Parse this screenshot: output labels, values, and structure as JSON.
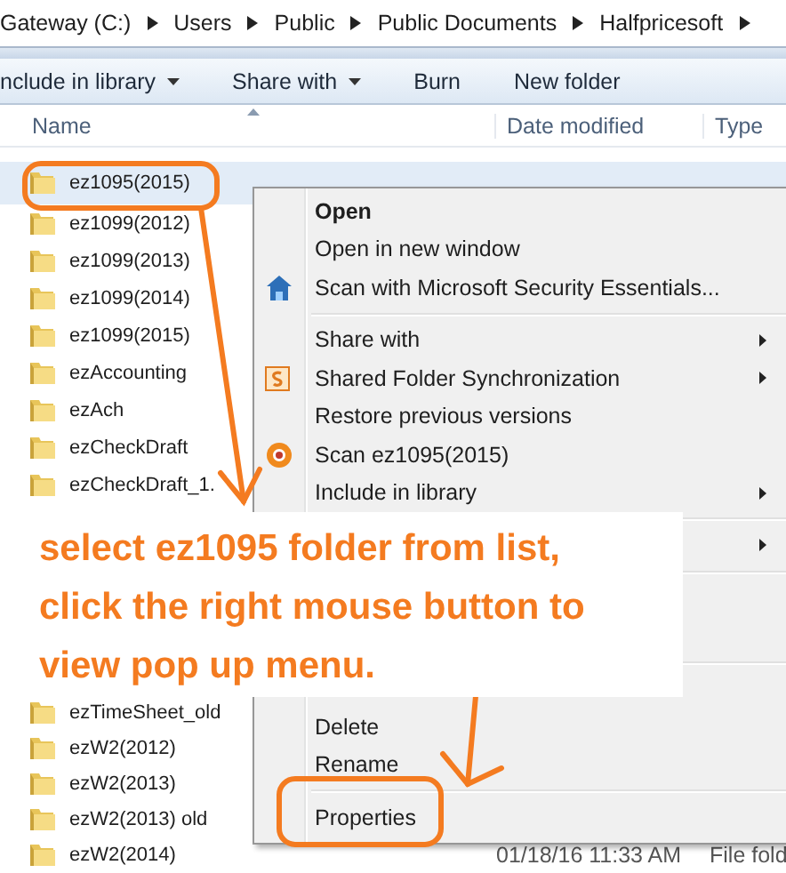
{
  "breadcrumb": [
    "Gateway (C:)",
    "Users",
    "Public",
    "Public Documents",
    "Halfpricesoft"
  ],
  "toolbar": [
    {
      "label": "nclude in library",
      "dropdown": true
    },
    {
      "label": "Share with",
      "dropdown": true
    },
    {
      "label": "Burn",
      "dropdown": false
    },
    {
      "label": "New folder",
      "dropdown": false
    }
  ],
  "columns": [
    "Name",
    "Date modified",
    "Type"
  ],
  "rows_above": [
    {
      "name": "ez1095(2015)",
      "selected": true
    },
    {
      "name": "ez1099(2012)",
      "selected": false
    },
    {
      "name": "ez1099(2013)",
      "selected": false
    },
    {
      "name": "ez1099(2014)",
      "selected": false
    },
    {
      "name": "ez1099(2015)",
      "selected": false
    },
    {
      "name": "ezAccounting",
      "selected": false
    },
    {
      "name": "ezAch",
      "selected": false
    },
    {
      "name": "ezCheckDraft",
      "selected": false
    },
    {
      "name": "ezCheckDraft_1.",
      "selected": false
    }
  ],
  "rows_below": [
    {
      "name": "ezTimeSheet_old",
      "selected": false
    },
    {
      "name": "ezW2(2012)",
      "selected": false
    },
    {
      "name": "ezW2(2013)",
      "selected": false
    },
    {
      "name": "ezW2(2013) old",
      "selected": false
    },
    {
      "name": "ezW2(2014)",
      "selected": false,
      "date": "01/18/16 11:33 AM",
      "type": "File fold"
    }
  ],
  "context_menu": [
    {
      "kind": "item",
      "label": "Open",
      "bold": true,
      "submenu": false
    },
    {
      "kind": "item",
      "label": "Open in new window",
      "bold": false,
      "submenu": false
    },
    {
      "kind": "item",
      "label": "Scan with Microsoft Security Essentials...",
      "bold": false,
      "submenu": false
    },
    {
      "kind": "separator"
    },
    {
      "kind": "item",
      "label": "Share with",
      "bold": false,
      "submenu": true
    },
    {
      "kind": "item",
      "label": "Shared Folder Synchronization",
      "bold": false,
      "submenu": true
    },
    {
      "kind": "item",
      "label": "Restore previous versions",
      "bold": false,
      "submenu": false
    },
    {
      "kind": "item",
      "label": "Scan ez1095(2015)",
      "bold": false,
      "submenu": false
    },
    {
      "kind": "item",
      "label": "Include in library",
      "bold": false,
      "submenu": true
    },
    {
      "kind": "separator"
    },
    {
      "kind": "covered",
      "submenu": true
    },
    {
      "kind": "separator"
    },
    {
      "kind": "covered",
      "submenu": false
    },
    {
      "kind": "covered",
      "submenu": false
    },
    {
      "kind": "separator"
    },
    {
      "kind": "covered",
      "submenu": false
    },
    {
      "kind": "item",
      "label": "Delete",
      "bold": false,
      "submenu": false
    },
    {
      "kind": "item",
      "label": "Rename",
      "bold": false,
      "submenu": false
    },
    {
      "kind": "separator"
    },
    {
      "kind": "item",
      "label": "Properties",
      "bold": false,
      "submenu": false
    }
  ],
  "note": [
    "select ez1095 folder from list,",
    "click the right mouse button to",
    "view pop up menu."
  ]
}
